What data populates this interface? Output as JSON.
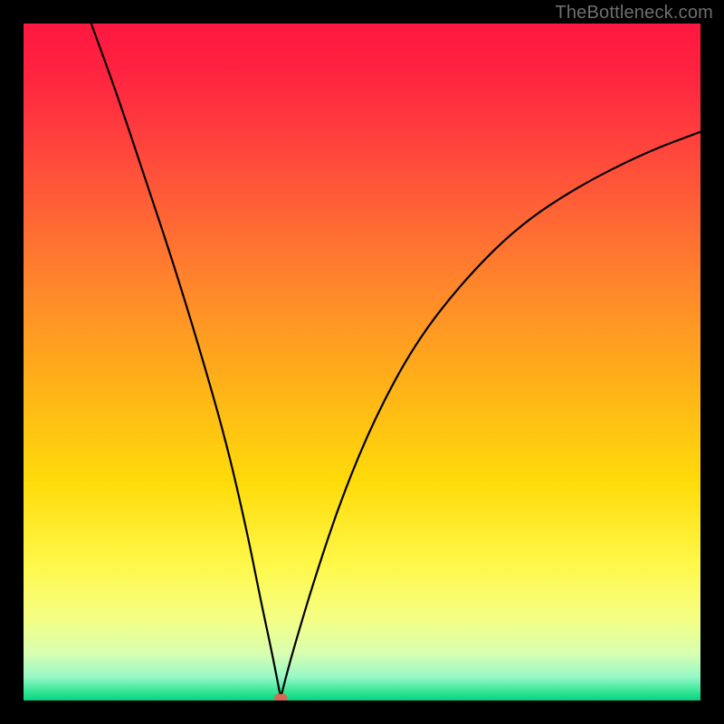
{
  "watermark": "TheBottleneck.com",
  "gradient_stops": [
    {
      "offset": 0.0,
      "color": "#ff173f"
    },
    {
      "offset": 0.07,
      "color": "#ff2340"
    },
    {
      "offset": 0.15,
      "color": "#ff3a3e"
    },
    {
      "offset": 0.25,
      "color": "#ff5a38"
    },
    {
      "offset": 0.4,
      "color": "#ff8a2a"
    },
    {
      "offset": 0.55,
      "color": "#ffb616"
    },
    {
      "offset": 0.68,
      "color": "#ffdc0a"
    },
    {
      "offset": 0.8,
      "color": "#fff84a"
    },
    {
      "offset": 0.88,
      "color": "#f4ff85"
    },
    {
      "offset": 0.93,
      "color": "#d9ffb0"
    },
    {
      "offset": 0.965,
      "color": "#97f8c8"
    },
    {
      "offset": 0.985,
      "color": "#3de89a"
    },
    {
      "offset": 1.0,
      "color": "#05d37e"
    }
  ],
  "chart_data": {
    "type": "line",
    "title": "",
    "xlabel": "",
    "ylabel": "",
    "x_range": [
      0,
      100
    ],
    "y_range": [
      0,
      100
    ],
    "min_x": 38,
    "series": [
      {
        "name": "bottleneck-curve",
        "x": [
          10,
          14,
          18,
          22,
          26,
          30,
          33,
          35,
          36.5,
          37.5,
          38,
          38.5,
          40,
          43,
          47,
          52,
          58,
          65,
          73,
          82,
          92,
          100
        ],
        "y": [
          100,
          89,
          77,
          65,
          52,
          38,
          25,
          15,
          8,
          3,
          0.3,
          2.5,
          8,
          18,
          30,
          42,
          53,
          62,
          70,
          76,
          81,
          84
        ]
      }
    ],
    "marker": {
      "x": 38,
      "y": 0.3,
      "color": "#d46a54"
    }
  }
}
